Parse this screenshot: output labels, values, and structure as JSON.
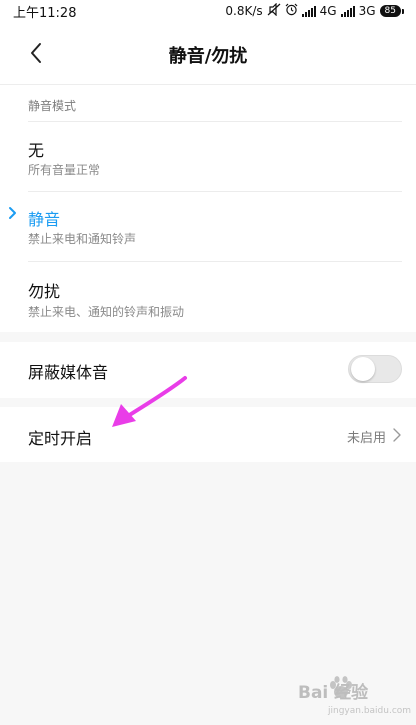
{
  "status_bar": {
    "time": "上午11:28",
    "net_speed": "0.8K/s",
    "sim1_type": "4G",
    "sim2_type": "3G",
    "battery": "85"
  },
  "header": {
    "title": "静音/勿扰"
  },
  "mode_section": {
    "label": "静音模式",
    "options": [
      {
        "title": "无",
        "subtitle": "所有音量正常",
        "selected": false
      },
      {
        "title": "静音",
        "subtitle": "禁止来电和通知铃声",
        "selected": true
      },
      {
        "title": "勿扰",
        "subtitle": "禁止来电、通知的铃声和振动",
        "selected": false
      }
    ]
  },
  "mute_media": {
    "label": "屏蔽媒体音",
    "enabled": false
  },
  "schedule": {
    "label": "定时开启",
    "value": "未启用"
  },
  "annotation": {
    "arrow_color": "#e93de8"
  },
  "watermark": {
    "text": "Bai 经验",
    "url": "jingyan.baidu.com"
  },
  "colors": {
    "accent": "#1b9cf2",
    "background": "#f7f7f7"
  }
}
